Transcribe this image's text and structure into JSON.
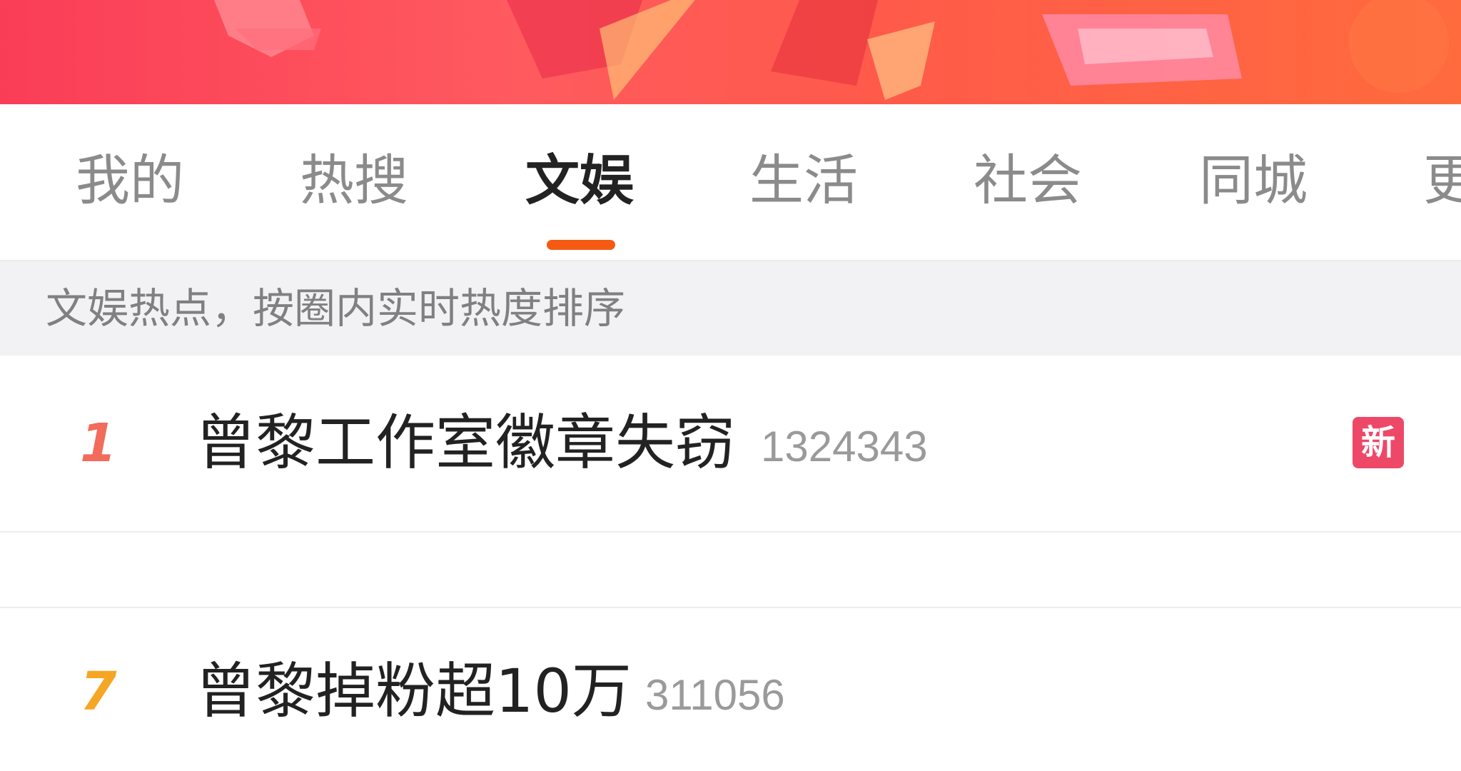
{
  "tabs": [
    {
      "label": "我的",
      "active": false
    },
    {
      "label": "热搜",
      "active": false
    },
    {
      "label": "文娱",
      "active": true
    },
    {
      "label": "生活",
      "active": false
    },
    {
      "label": "社会",
      "active": false
    },
    {
      "label": "同城",
      "active": false
    },
    {
      "label": "更",
      "active": false
    }
  ],
  "hint": {
    "text": "文娱热点，按圈内实时热度排序"
  },
  "rows": [
    {
      "rank": "1",
      "title": "曾黎工作室徽章失窃",
      "heat": "1324343",
      "badge": "新",
      "rank_color": "#f26b5b",
      "badge_color": "#ee4868"
    },
    {
      "rank": "7",
      "title": "曾黎掉粉超10万",
      "heat": "311056",
      "rank_color": "#f5a623"
    }
  ],
  "colors": {
    "accent": "#f55a12",
    "banner": "#fa4a5a"
  }
}
